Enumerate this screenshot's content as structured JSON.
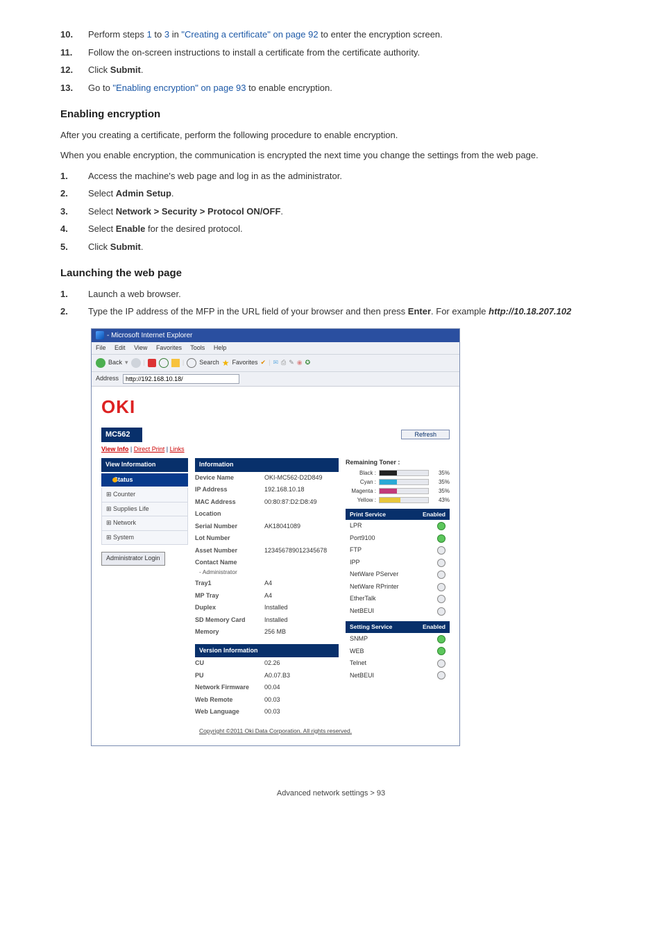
{
  "doc": {
    "steps10_13": [
      {
        "n": "10.",
        "pre": "Perform steps ",
        "l1": "1",
        "mid": " to ",
        "l2": "3",
        "mid2": " in ",
        "l3": "\"Creating a certificate\" on page 92",
        "post": " to enter the encryption screen."
      },
      {
        "n": "11.",
        "text": "Follow the on-screen instructions to install a certificate from the certificate authority."
      },
      {
        "n": "12.",
        "pre": "Click ",
        "bold": "Submit",
        "post": "."
      },
      {
        "n": "13.",
        "pre": "Go to ",
        "link": "\"Enabling encryption\" on page 93",
        "post": " to enable encryption."
      }
    ],
    "h_enable": "Enabling encryption",
    "p_enable1": "After you creating a certificate, perform the following procedure to enable encryption.",
    "p_enable2": "When you enable encryption, the communication is encrypted the next time you change the settings from the web page.",
    "steps_enable": [
      {
        "n": "1.",
        "text": "Access the machine's web page and log in as the administrator."
      },
      {
        "n": "2.",
        "pre": "Select ",
        "bold": "Admin Setup",
        "post": "."
      },
      {
        "n": "3.",
        "pre": "Select ",
        "bold": "Network > Security > Protocol ON/OFF",
        "post": "."
      },
      {
        "n": "4.",
        "pre": "Select ",
        "bold": "Enable",
        "post": " for the desired protocol."
      },
      {
        "n": "5.",
        "pre": "Click ",
        "bold": "Submit",
        "post": "."
      }
    ],
    "h_launch": "Launching the web page",
    "steps_launch": [
      {
        "n": "1.",
        "text": "Launch a web browser."
      },
      {
        "n": "2.",
        "pre": "Type the IP address of the MFP in the URL field of your browser and then press ",
        "bold": "Enter",
        "mid": ". For example ",
        "url": "http://10.18.207.102"
      }
    ],
    "footer": "Advanced network settings > 93"
  },
  "ss": {
    "title": "- Microsoft Internet Explorer",
    "menus": [
      "File",
      "Edit",
      "View",
      "Favorites",
      "Tools",
      "Help"
    ],
    "toolbar": {
      "back": "Back",
      "search": "Search",
      "favorites": "Favorites"
    },
    "addressLabel": "Address",
    "addressValue": "http://192.168.10.18/",
    "logo": "OKI",
    "model": "MC562",
    "refresh": "Refresh",
    "tabs": {
      "view": "View Info",
      "direct": "Direct Print",
      "links": "Links"
    },
    "left": {
      "viewInfo": "View Information",
      "status": "Status",
      "items": [
        "Counter",
        "Supplies Life",
        "Network",
        "System"
      ],
      "login": "Administrator Login"
    },
    "info": {
      "hdr": "Information",
      "rows": [
        {
          "k": "Device Name",
          "v": "OKI-MC562-D2D849"
        },
        {
          "k": "IP Address",
          "v": "192.168.10.18"
        },
        {
          "k": "MAC Address",
          "v": "00:80:87:D2:D8:49"
        },
        {
          "k": "Location",
          "v": ""
        },
        {
          "k": "Serial Number",
          "v": "AK18041089"
        },
        {
          "k": "Lot Number",
          "v": ""
        },
        {
          "k": "Asset Number",
          "v": "123456789012345678"
        },
        {
          "k": "Contact Name",
          "sub": "- Administrator",
          "v": ""
        },
        {
          "k": "Tray1",
          "v": "A4"
        },
        {
          "k": "MP Tray",
          "v": "A4"
        },
        {
          "k": "Duplex",
          "v": "Installed"
        },
        {
          "k": "SD Memory Card",
          "v": "Installed"
        },
        {
          "k": "Memory",
          "v": "256 MB"
        }
      ],
      "hdr2": "Version Information",
      "rows2": [
        {
          "k": "CU",
          "v": "02.26"
        },
        {
          "k": "PU",
          "v": "A0.07.B3"
        },
        {
          "k": "Network Firmware",
          "v": "00.04"
        },
        {
          "k": "Web Remote",
          "v": "00.03"
        },
        {
          "k": "Web Language",
          "v": "00.03"
        }
      ]
    },
    "toner": {
      "title": "Remaining Toner :",
      "rows": [
        {
          "label": "Black :",
          "pct": 35,
          "color": "#222"
        },
        {
          "label": "Cyan :",
          "pct": 35,
          "color": "#2aa9d6"
        },
        {
          "label": "Magenta :",
          "pct": 35,
          "color": "#c23a7a"
        },
        {
          "label": "Yellow :",
          "pct": 43,
          "color": "#e7c63c"
        }
      ]
    },
    "printSvc": {
      "hdr": [
        "Print Service",
        "Enabled"
      ],
      "rows": [
        {
          "name": "LPR",
          "on": true
        },
        {
          "name": "Port9100",
          "on": true
        },
        {
          "name": "FTP",
          "on": false
        },
        {
          "name": "IPP",
          "on": false
        },
        {
          "name": "NetWare PServer",
          "on": false
        },
        {
          "name": "NetWare RPrinter",
          "on": false
        },
        {
          "name": "EtherTalk",
          "on": false
        },
        {
          "name": "NetBEUI",
          "on": false
        }
      ]
    },
    "settingSvc": {
      "hdr": [
        "Setting Service",
        "Enabled"
      ],
      "rows": [
        {
          "name": "SNMP",
          "on": true
        },
        {
          "name": "WEB",
          "on": true
        },
        {
          "name": "Telnet",
          "on": false
        },
        {
          "name": "NetBEUI",
          "on": false
        }
      ]
    },
    "copyright": "Copyright ©2011 Oki Data Corporation. All rights reserved."
  }
}
